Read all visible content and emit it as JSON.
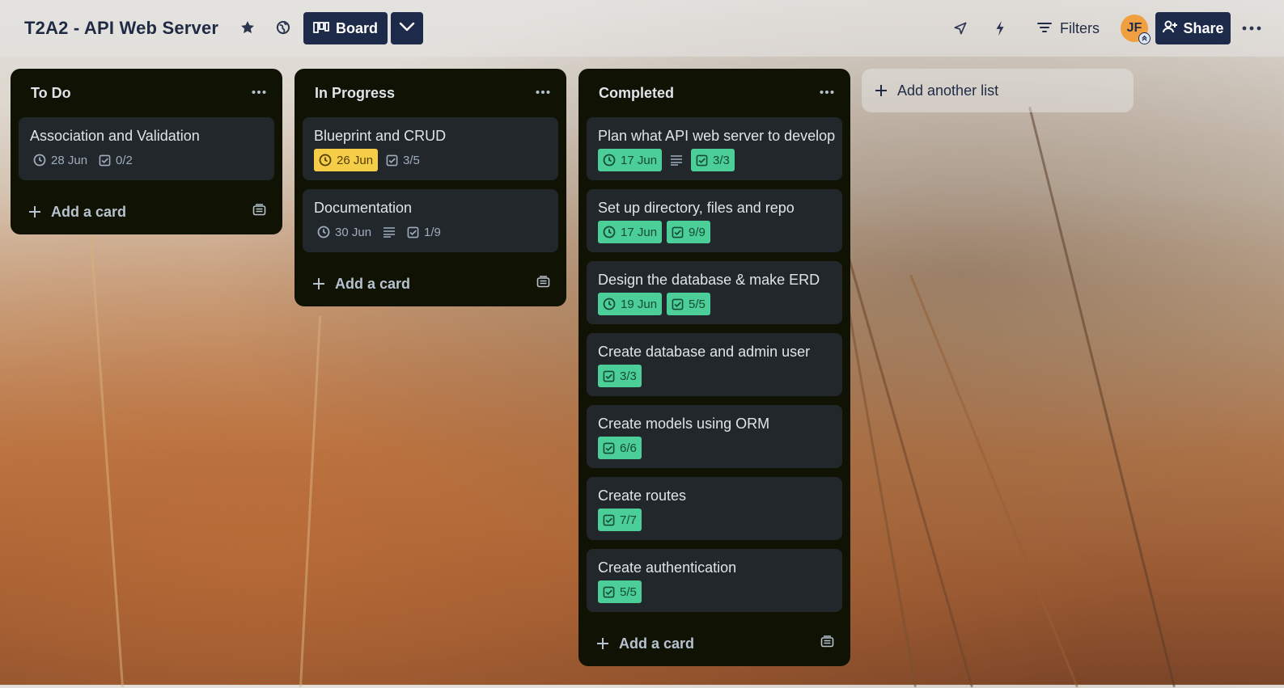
{
  "board": {
    "title": "T2A2 - API Web Server",
    "view_label": "Board",
    "filters_label": "Filters",
    "share_label": "Share",
    "avatar_initials": "JF"
  },
  "colors": {
    "list_bg": "#101204",
    "card_bg": "#22272b",
    "header_button": "#1d2a4a",
    "badge_yellow": "#f5cd47",
    "badge_green": "#4bce97",
    "avatar": "#f0a040"
  },
  "icons": [
    "star-icon",
    "globe-icon",
    "board-icon",
    "chevron-down-icon",
    "rocket-icon",
    "bolt-icon",
    "filter-icon",
    "add-user-icon",
    "more-icon",
    "clock-icon",
    "checklist-icon",
    "description-icon",
    "plus-icon",
    "template-icon"
  ],
  "add_card_label": "Add a card",
  "add_list_label": "Add another list",
  "lists": [
    {
      "title": "To Do",
      "cards": [
        {
          "title": "Association and Validation",
          "date": "28 Jun",
          "date_status": "none",
          "has_description": false,
          "checklist": "0/2",
          "checklist_status": "none"
        }
      ]
    },
    {
      "title": "In Progress",
      "cards": [
        {
          "title": "Blueprint and CRUD",
          "date": "26 Jun",
          "date_status": "due-soon",
          "has_description": false,
          "checklist": "3/5",
          "checklist_status": "none"
        },
        {
          "title": "Documentation",
          "date": "30 Jun",
          "date_status": "none",
          "has_description": true,
          "checklist": "1/9",
          "checklist_status": "none"
        }
      ]
    },
    {
      "title": "Completed",
      "cards": [
        {
          "title": "Plan what API web server to develop",
          "date": "17 Jun",
          "date_status": "complete",
          "has_description": true,
          "checklist": "3/3",
          "checklist_status": "complete"
        },
        {
          "title": "Set up directory, files and repo",
          "date": "17 Jun",
          "date_status": "complete",
          "has_description": false,
          "checklist": "9/9",
          "checklist_status": "complete"
        },
        {
          "title": "Design the database & make ERD",
          "date": "19 Jun",
          "date_status": "complete",
          "has_description": false,
          "checklist": "5/5",
          "checklist_status": "complete"
        },
        {
          "title": "Create database and admin user",
          "date": null,
          "date_status": "none",
          "has_description": false,
          "checklist": "3/3",
          "checklist_status": "complete"
        },
        {
          "title": "Create models using ORM",
          "date": null,
          "date_status": "none",
          "has_description": false,
          "checklist": "6/6",
          "checklist_status": "complete"
        },
        {
          "title": "Create routes",
          "date": null,
          "date_status": "none",
          "has_description": false,
          "checklist": "7/7",
          "checklist_status": "complete"
        },
        {
          "title": "Create authentication",
          "date": null,
          "date_status": "none",
          "has_description": false,
          "checklist": "5/5",
          "checklist_status": "complete"
        }
      ]
    }
  ]
}
